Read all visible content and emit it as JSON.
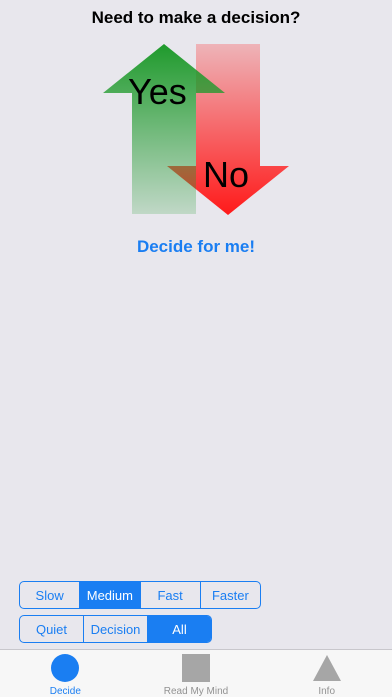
{
  "header": {
    "title": "Need to make a decision?"
  },
  "graphic": {
    "yes_label": "Yes",
    "no_label": "No"
  },
  "action": {
    "decide_label": "Decide for me!"
  },
  "speed": {
    "options": [
      "Slow",
      "Medium",
      "Fast",
      "Faster"
    ],
    "selected": "Medium"
  },
  "sound": {
    "options": [
      "Quiet",
      "Decision",
      "All"
    ],
    "selected": "All"
  },
  "tabs": [
    {
      "label": "Decide",
      "icon": "circle-icon",
      "active": true
    },
    {
      "label": "Read My Mind",
      "icon": "square-icon",
      "active": false
    },
    {
      "label": "Info",
      "icon": "triangle-icon",
      "active": false
    }
  ],
  "colors": {
    "accent": "#1a7ef2",
    "yes_green": "#1f9a2c",
    "no_red": "#ff1a1a",
    "background": "#e8e7ed"
  }
}
